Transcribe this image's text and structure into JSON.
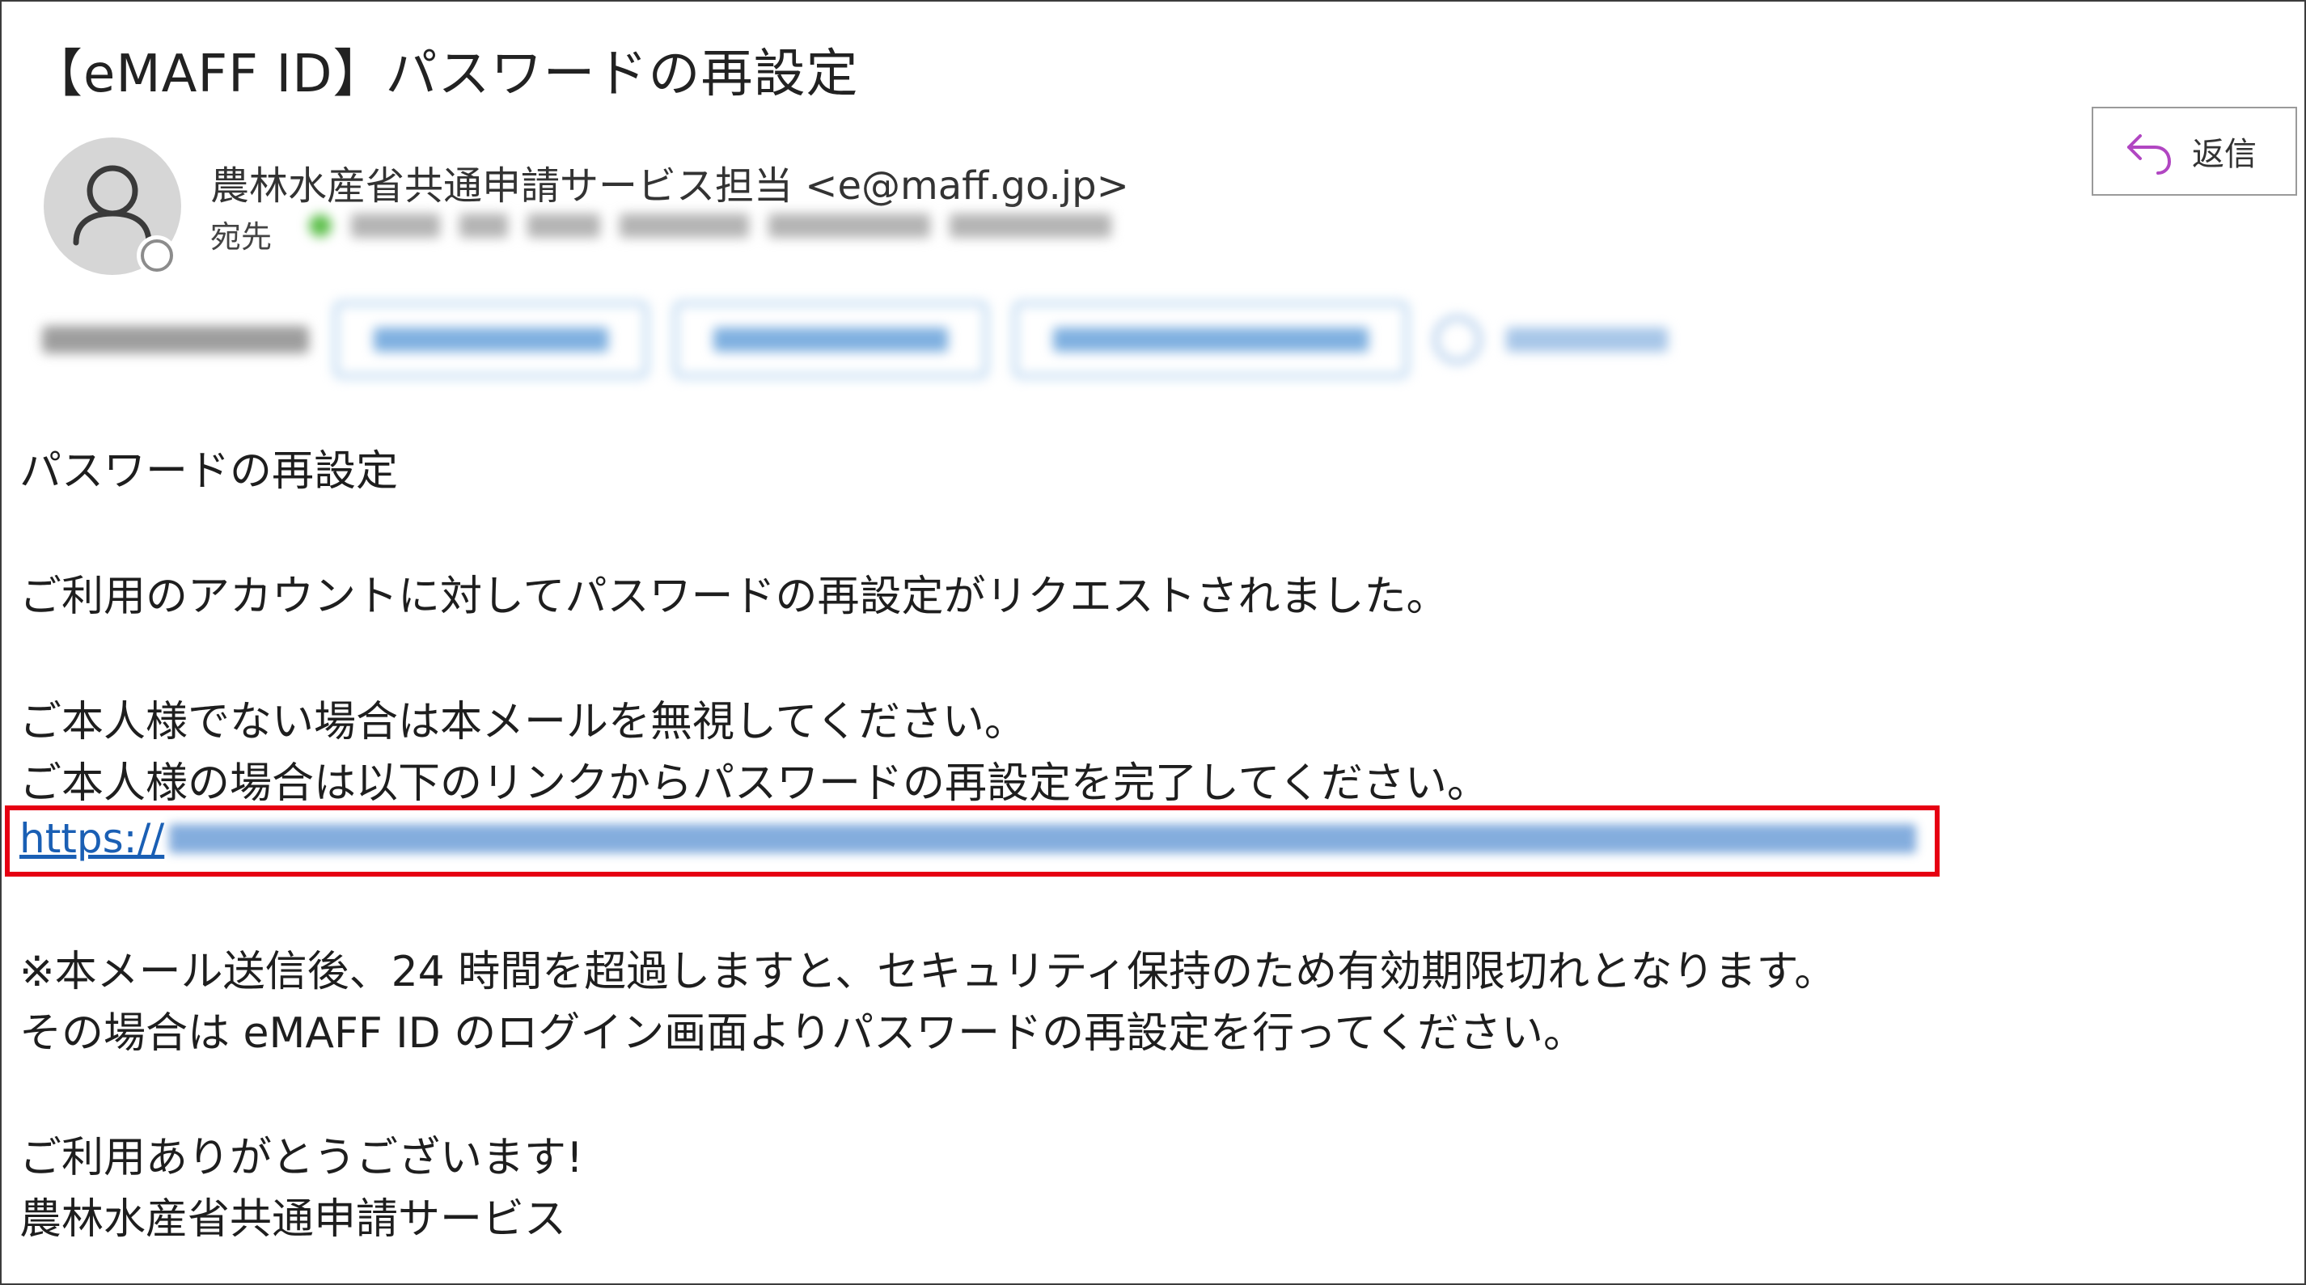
{
  "email": {
    "subject": "【eMAFF ID】パスワードの再設定",
    "sender": "農林水産省共通申請サービス担当 <e@maff.go.jp>",
    "to_label": "宛先",
    "reply_label": "返信",
    "link_prefix": "https://",
    "body": {
      "heading": "パスワードの再設定",
      "line1": "ご利用のアカウントに対してパスワードの再設定がリクエストされました。",
      "line2": "ご本人様でない場合は本メールを無視してください。",
      "line3": "ご本人様の場合は以下のリンクからパスワードの再設定を完了してください。",
      "line4": "※本メール送信後、24 時間を超過しますと、セキュリティ保持のため有効期限切れとなります。",
      "line5": "その場合は eMAFF ID のログイン画面よりパスワードの再設定を行ってください。",
      "line6": "ご利用ありがとうございます!",
      "line7": "農林水産省共通申請サービス"
    }
  },
  "icons": {
    "reply": "reply-arrow-icon",
    "avatar": "person-icon",
    "presence": "presence-status-icon"
  },
  "colors": {
    "highlight": "#e60012",
    "link": "#1a5fb4",
    "reply_arrow": "#b146c2"
  }
}
